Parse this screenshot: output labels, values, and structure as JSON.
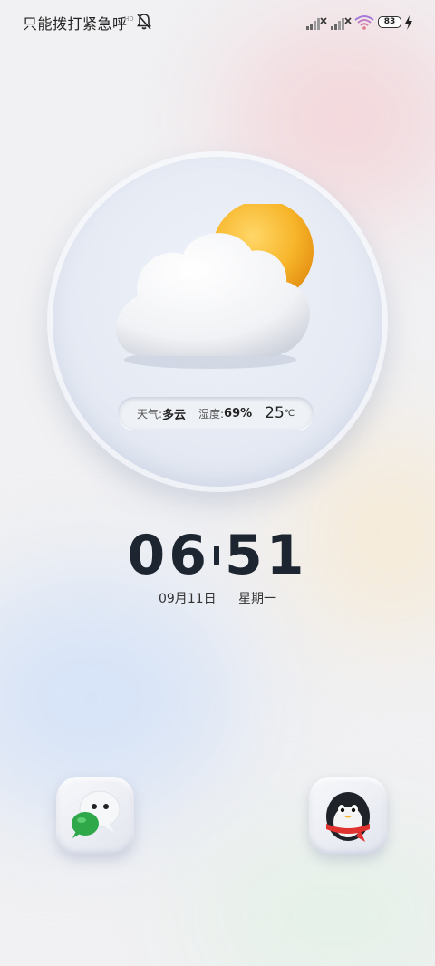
{
  "status_bar": {
    "carrier_text": "只能拨打紧急呼",
    "hd_label": "HD",
    "battery_level": "83",
    "icons": [
      "bell-off-icon",
      "signal-x-icon",
      "signal-x-icon",
      "wifi-icon",
      "battery-icon",
      "charging-icon"
    ]
  },
  "weather": {
    "condition_label": "天气:",
    "condition_value": "多云",
    "humidity_label": "湿度:",
    "humidity_value": "69%",
    "temperature": "25",
    "temperature_unit": "℃",
    "icon": "cloudy-sun-icon"
  },
  "clock": {
    "hours": "06",
    "minutes": "51",
    "date": "09月11日",
    "weekday": "星期一"
  },
  "shortcuts": [
    {
      "icon": "wechat-icon"
    },
    {
      "icon": "qq-icon"
    }
  ],
  "colors": {
    "sun": "#f7b52a",
    "clock_text": "#1d2530",
    "wechat_green": "#2fa84a",
    "qq_scarf": "#e0322f"
  }
}
